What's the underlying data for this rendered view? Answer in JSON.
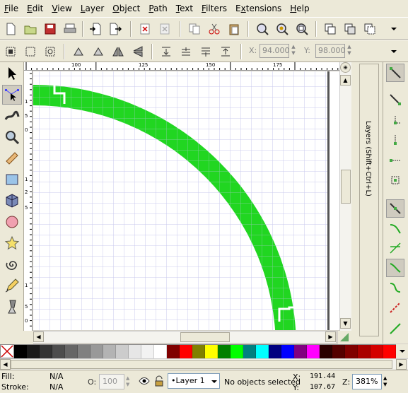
{
  "menu": [
    {
      "label": "File",
      "u": "F",
      "rest": "ile"
    },
    {
      "label": "Edit",
      "u": "E",
      "rest": "dit"
    },
    {
      "label": "View",
      "u": "V",
      "rest": "iew"
    },
    {
      "label": "Layer",
      "u": "L",
      "rest": "ayer"
    },
    {
      "label": "Object",
      "u": "O",
      "rest": "bject"
    },
    {
      "label": "Path",
      "u": "P",
      "rest": "ath"
    },
    {
      "label": "Text",
      "u": "T",
      "rest": "ext"
    },
    {
      "label": "Filters",
      "u": "F",
      "rest": "ilters"
    },
    {
      "label": "Extensions",
      "u": "x",
      "rest": "tensions"
    },
    {
      "label": "Help",
      "u": "H",
      "rest": "elp"
    }
  ],
  "ctrl": {
    "x_label": "X:",
    "x_value": "94.000",
    "y_label": "Y:",
    "y_value": "98.000"
  },
  "ruler": {
    "h_ticks": [
      "100",
      "125",
      "150",
      "175"
    ],
    "v_ticks": [
      "1",
      "5",
      "0",
      "1",
      "2",
      "5",
      "1",
      "5",
      "0"
    ]
  },
  "dock": {
    "layers_tab": "Layers (Shift+Ctrl+L)"
  },
  "palette": [
    "#000000",
    "#1a1a1a",
    "#333333",
    "#4d4d4d",
    "#666666",
    "#808080",
    "#999999",
    "#b3b3b3",
    "#cccccc",
    "#e6e6e6",
    "#f2f2f2",
    "#ffffff",
    "#800000",
    "#ff0000",
    "#808000",
    "#ffff00",
    "#008000",
    "#00ff00",
    "#008080",
    "#00ffff",
    "#000080",
    "#0000ff",
    "#800080",
    "#ff00ff",
    "#2b0000",
    "#550000",
    "#800000",
    "#aa0000",
    "#d40000",
    "#ff0000"
  ],
  "status": {
    "fill_label": "Fill:",
    "fill_value": "N/A",
    "stroke_label": "Stroke:",
    "stroke_value": "N/A",
    "opacity_label": "O:",
    "opacity_value": "100",
    "layer_value": "Layer 1",
    "message": "No objects selected",
    "x_label": "X:",
    "x_value": "191.44",
    "y_label": "Y:",
    "y_value": "107.67",
    "zoom_label": "Z:",
    "zoom_value": "381%"
  },
  "colors": {
    "ring": "#1ad51a",
    "grid": "#c8c8ee",
    "chrome": "#ece9d8"
  }
}
